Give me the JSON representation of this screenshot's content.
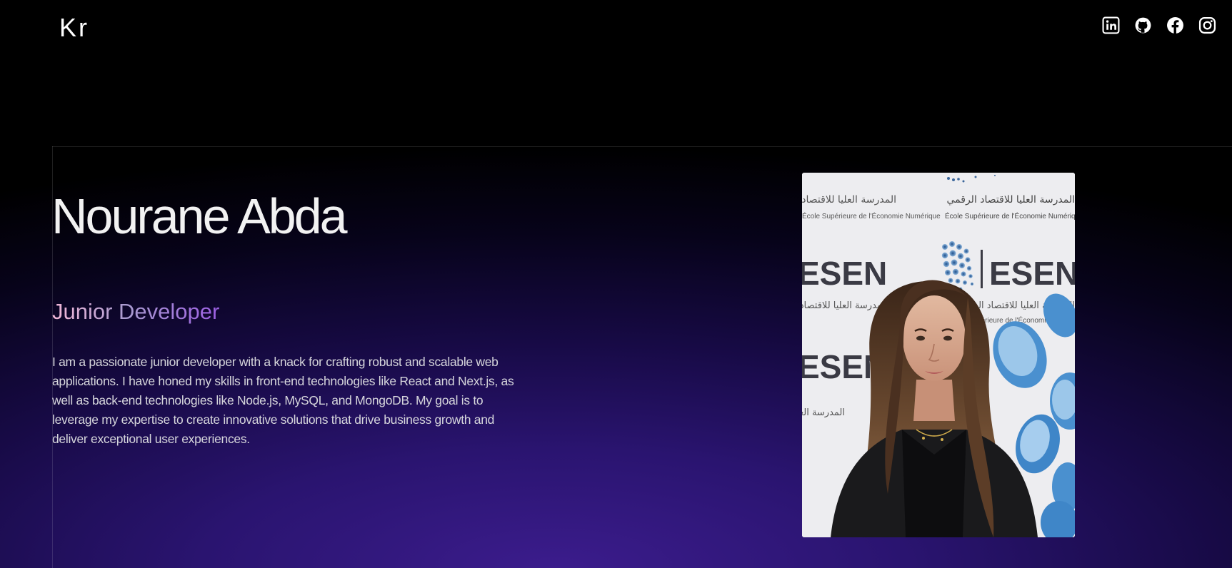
{
  "header": {
    "logo": "Kr",
    "social": [
      {
        "name": "linkedin-icon"
      },
      {
        "name": "github-icon"
      },
      {
        "name": "facebook-icon"
      },
      {
        "name": "instagram-icon"
      }
    ]
  },
  "hero": {
    "name": "Nourane Abda",
    "role": "Junior Developer",
    "bio": "I am a passionate junior developer with a knack for crafting robust and scalable web applications. I have honed my skills in front-end technologies like React and Next.js, as well as back-end technologies like Node.js, MySQL, and MongoDB. My goal is to leverage my expertise to create innovative solutions that drive business growth and deliver exceptional user experiences."
  },
  "photo": {
    "backdrop_logo_text": "ESEN",
    "backdrop_arabic": "المدرسة العليا للاقتصاد الرقمي",
    "backdrop_french": "École Supérieure de l'Économie Numérique"
  },
  "colors": {
    "background": "#000000",
    "gradient_purple": "#3b1c8c",
    "role_gradient_start": "#f3b8d8",
    "role_gradient_end": "#9c5fe3",
    "esen_blue": "#3a84c9"
  }
}
